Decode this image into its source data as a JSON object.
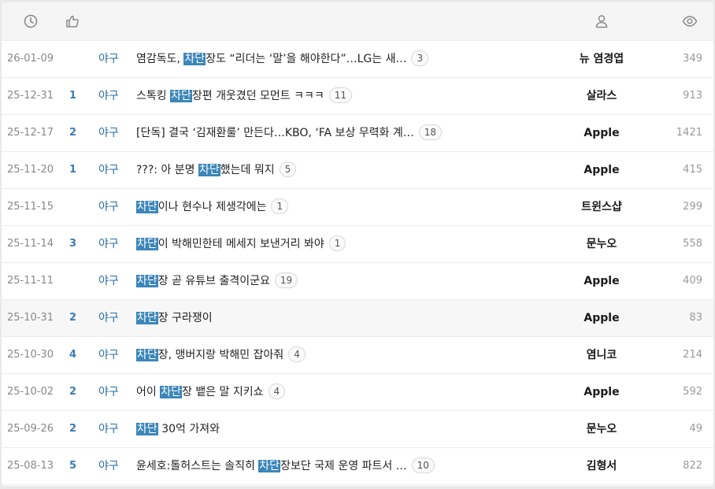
{
  "header": {
    "icons": [
      "clock-icon",
      "thumbs-up-icon",
      "user-icon",
      "eye-icon"
    ]
  },
  "rows": [
    {
      "date": "26-01-09",
      "rec": "",
      "cat": "야구",
      "pre": "염감독도, ",
      "hl": "차단",
      "post": "장도 “리더는 ‘말’을 해야한다”…LG는 새…",
      "comments": "3",
      "author": "뉴 염경엽",
      "views": "349"
    },
    {
      "date": "25-12-31",
      "rec": "1",
      "cat": "야구",
      "pre": "스톡킹 ",
      "hl": "차단",
      "post": "장편 개웃겼던 모먼트 ㅋㅋㅋ",
      "comments": "11",
      "author": "살라스",
      "views": "913"
    },
    {
      "date": "25-12-17",
      "rec": "2",
      "cat": "야구",
      "pre": "[단독] 결국 ‘김재환룰’ 만든다…KBO, ‘FA 보상 무력화 계…",
      "hl": "",
      "post": "",
      "comments": "18",
      "author": "Apple",
      "views": "1421"
    },
    {
      "date": "25-11-20",
      "rec": "1",
      "cat": "야구",
      "pre": "???: 아 분명 ",
      "hl": "차단",
      "post": "했는데 뭐지",
      "comments": "5",
      "author": "Apple",
      "views": "415"
    },
    {
      "date": "25-11-15",
      "rec": "",
      "cat": "야구",
      "pre": "",
      "hl": "차단",
      "post": "이나 현수나 제생각에는",
      "comments": "1",
      "author": "트윈스샵",
      "views": "299"
    },
    {
      "date": "25-11-14",
      "rec": "3",
      "cat": "야구",
      "pre": "",
      "hl": "차단",
      "post": "이 박해민한테 메세지 보낸거리 봐야",
      "comments": "1",
      "author": "문누오",
      "views": "558"
    },
    {
      "date": "25-11-11",
      "rec": "",
      "cat": "야구",
      "pre": "",
      "hl": "차단",
      "post": "장 곧 유튜브 출격이군요",
      "comments": "19",
      "author": "Apple",
      "views": "409"
    },
    {
      "date": "25-10-31",
      "rec": "2",
      "cat": "야구",
      "pre": "",
      "hl": "차단",
      "post": "장 구라쟁이",
      "comments": "",
      "author": "Apple",
      "views": "83"
    },
    {
      "date": "25-10-30",
      "rec": "4",
      "cat": "야구",
      "pre": "",
      "hl": "차단",
      "post": "장, 맹버지랑 박해민 잡아줘",
      "comments": "4",
      "author": "염니코",
      "views": "214"
    },
    {
      "date": "25-10-02",
      "rec": "2",
      "cat": "야구",
      "pre": "어이 ",
      "hl": "차단",
      "post": "장 뱉은 말 지키쇼",
      "comments": "4",
      "author": "Apple",
      "views": "592"
    },
    {
      "date": "25-09-26",
      "rec": "2",
      "cat": "야구",
      "pre": "",
      "hl": "차단",
      "post": " 30억 가져와",
      "comments": "",
      "author": "문누오",
      "views": "49"
    },
    {
      "date": "25-08-13",
      "rec": "5",
      "cat": "야구",
      "pre": "윤세호:톨허스트는 솔직히 ",
      "hl": "차단",
      "post": "장보단 국제 운영 파트서 …",
      "comments": "10",
      "author": "김형서",
      "views": "822"
    }
  ]
}
